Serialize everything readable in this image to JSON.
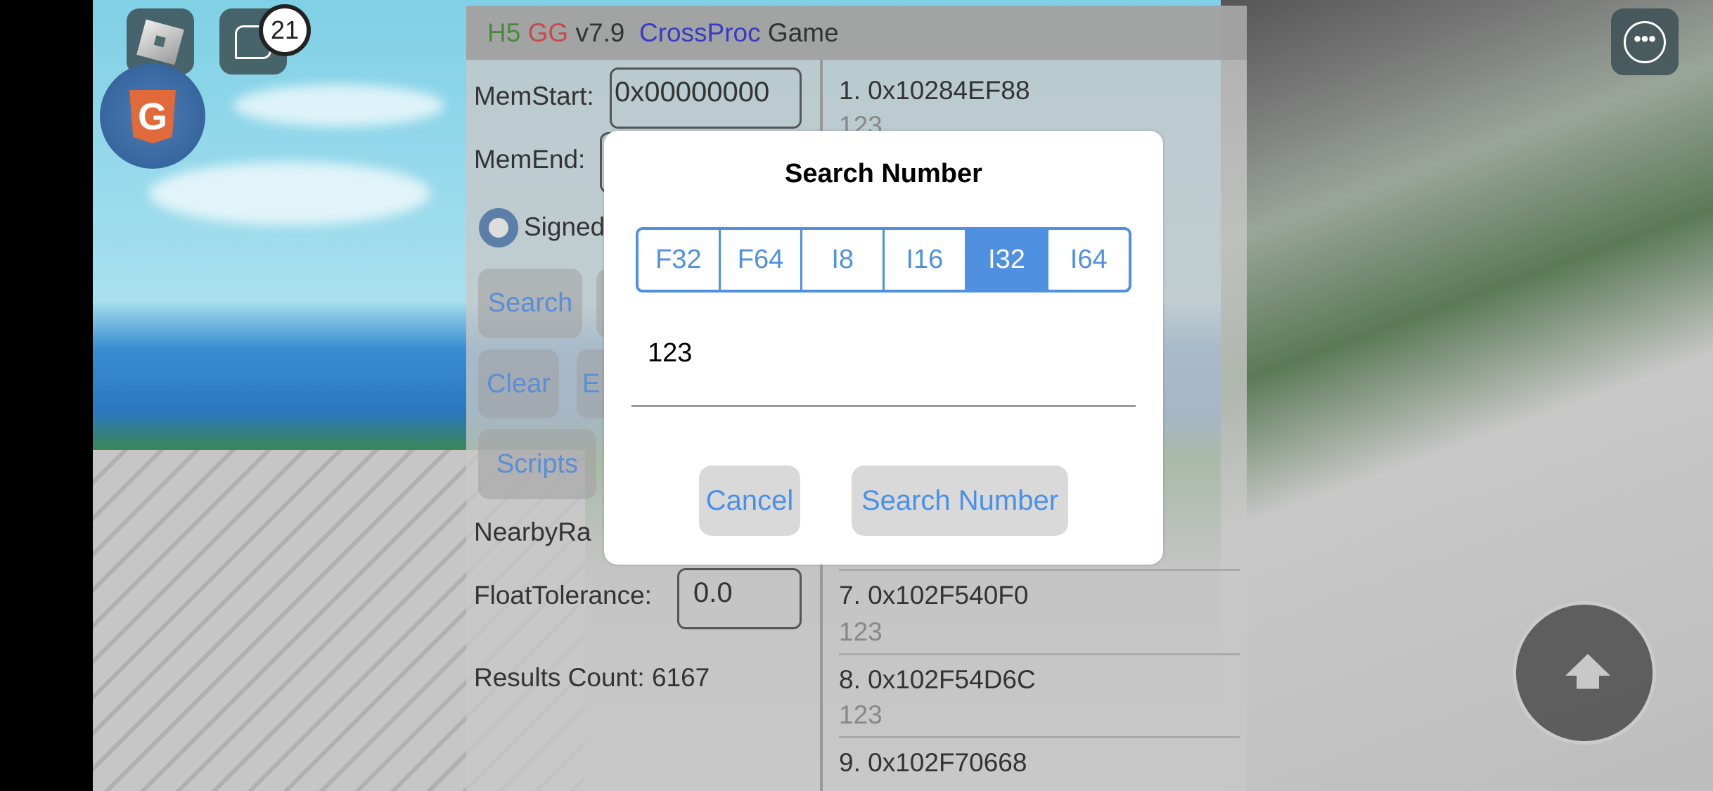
{
  "hud": {
    "chat_badge": "21",
    "icons": [
      "roblox-menu-icon",
      "chat-icon",
      "h5gg-logo-icon",
      "more-icon",
      "jump-icon"
    ]
  },
  "header": {
    "h5": "H5",
    "gg": "GG",
    "version": "v7.9",
    "crossproc": "CrossProc",
    "game": "Game",
    "colors": {
      "h5": "#4a8a3c",
      "gg": "#c84a4a",
      "crossproc": "#3a3ac8"
    }
  },
  "left": {
    "memstart_label": "MemStart:",
    "memstart_value": "0x00000000",
    "memend_label": "MemEnd:",
    "signed_label": "Signed",
    "search_btn": "Search",
    "clear_btn": "Clear",
    "e_btn": "E",
    "scripts_btn": "Scripts",
    "nearby_label": "NearbyRa",
    "float_label": "FloatTolerance:",
    "float_value": "0.0",
    "results_count": "Results Count: 6167"
  },
  "results": [
    {
      "addr": "1. 0x10284EF88",
      "value": "123"
    },
    {
      "addr": "7. 0x102F540F0",
      "value": "123"
    },
    {
      "addr": "8. 0x102F54D6C",
      "value": "123"
    },
    {
      "addr": "9. 0x102F70668"
    }
  ],
  "dialog": {
    "title": "Search Number",
    "types": [
      "F32",
      "F64",
      "I8",
      "I16",
      "I32",
      "I64"
    ],
    "selected_type": "I32",
    "value": "123",
    "cancel": "Cancel",
    "confirm": "Search Number",
    "accent": "#5090e0"
  }
}
